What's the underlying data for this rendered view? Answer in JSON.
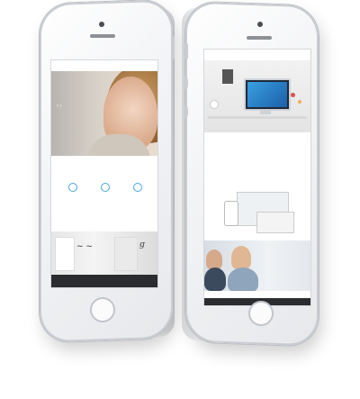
{
  "phone_left": {
    "site": {
      "logo": "",
      "nav": "",
      "hero_title": "",
      "hero_arrows": "‹  ›",
      "intro": "",
      "features": [
        {
          "label": "",
          "text": ""
        },
        {
          "label": "",
          "text": ""
        },
        {
          "label": "",
          "text": ""
        }
      ],
      "section_title": "",
      "footer": ""
    }
  },
  "phone_right": {
    "site": {
      "logo": "",
      "nav": "",
      "columns": [
        {
          "title": "",
          "text": ""
        },
        {
          "title": "",
          "text": ""
        }
      ],
      "headline": "",
      "side_text": ""
    }
  },
  "colors": {
    "accent": "#4aa6d9",
    "phone_frame": "#f3f4f6",
    "footer": "#2a2c2f"
  }
}
